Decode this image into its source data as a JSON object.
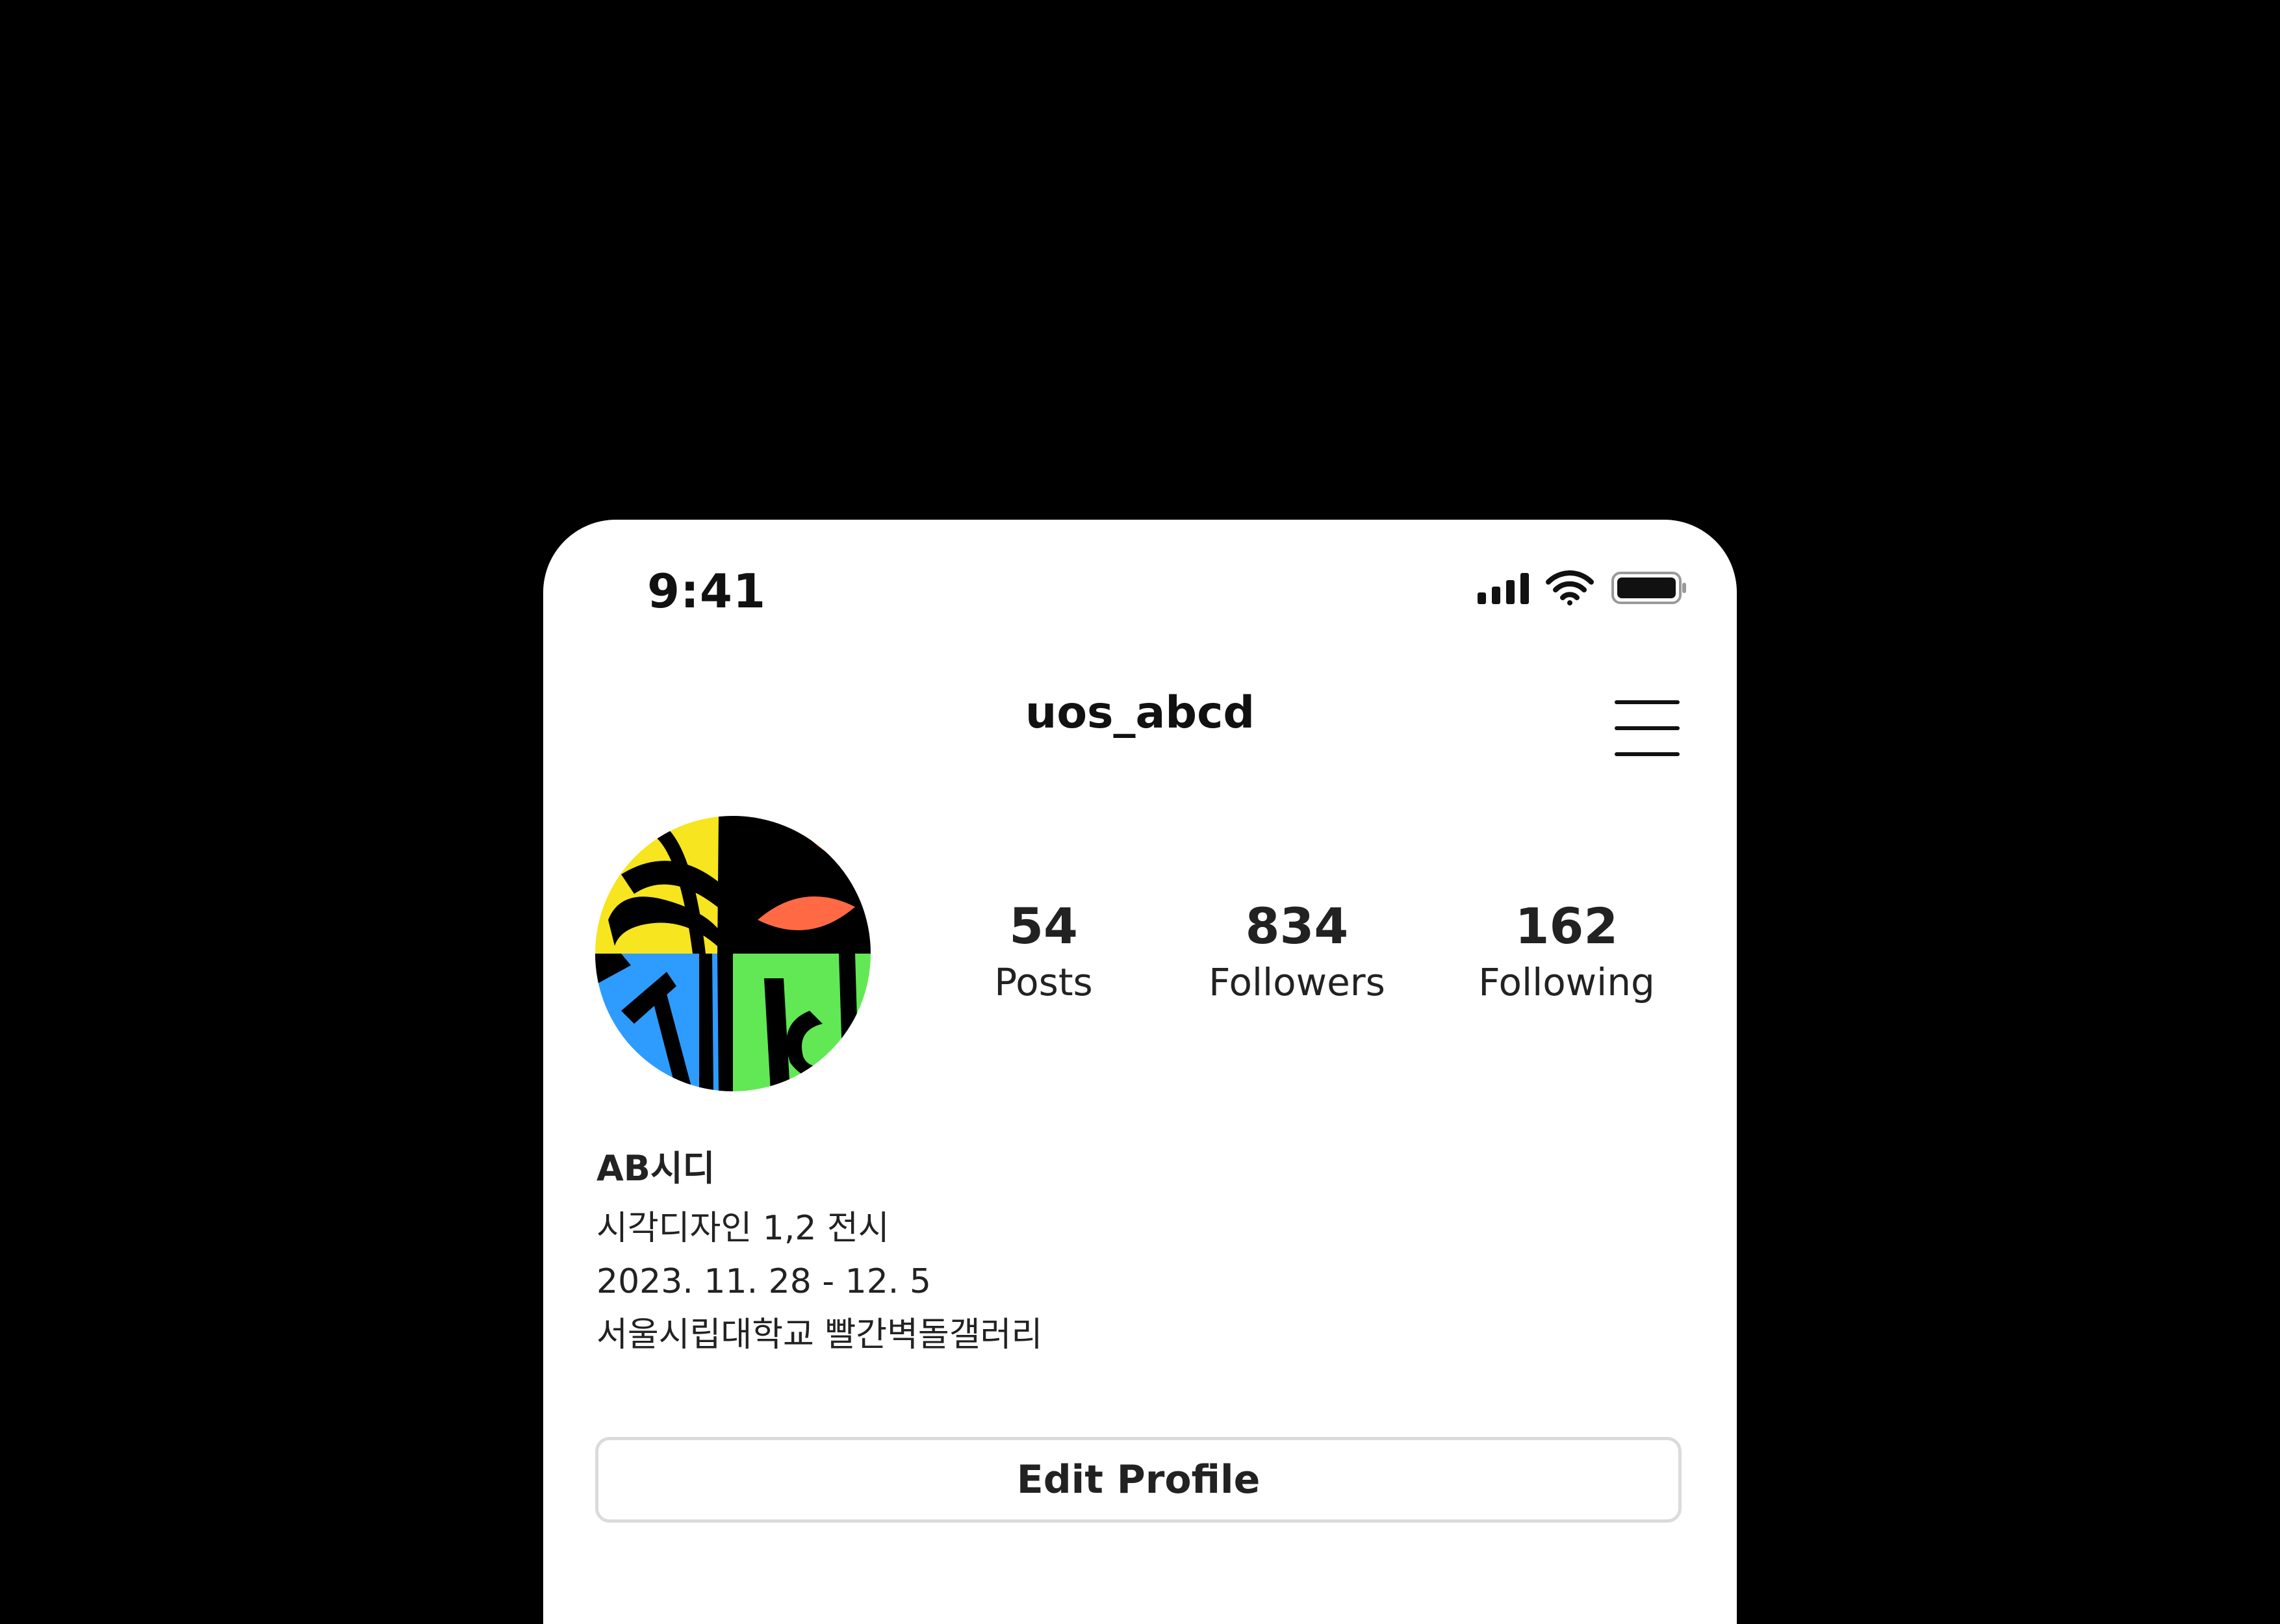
{
  "status_bar": {
    "time": "9:41",
    "icons": [
      "signal-icon",
      "wifi-icon",
      "battery-icon"
    ]
  },
  "header": {
    "username": "uos_abcd",
    "menu_icon": "hamburger-menu-icon"
  },
  "profile": {
    "avatar": "ab-sidi-logo",
    "avatar_colors": {
      "yellow": "#f6e51f",
      "orange": "#ff6a45",
      "blue": "#2e9cff",
      "green": "#62e855",
      "black": "#000000"
    },
    "stats": {
      "posts": {
        "value": "54",
        "label": "Posts"
      },
      "followers": {
        "value": "834",
        "label": "Followers"
      },
      "following": {
        "value": "162",
        "label": "Following"
      }
    },
    "bio": {
      "name": "AB시디",
      "lines": [
        "시각디자인 1,2 전시",
        "2023. 11. 28 - 12. 5",
        "서울시립대학교 빨간벽돌갤러리"
      ]
    }
  },
  "actions": {
    "edit_profile_label": "Edit Profile"
  }
}
